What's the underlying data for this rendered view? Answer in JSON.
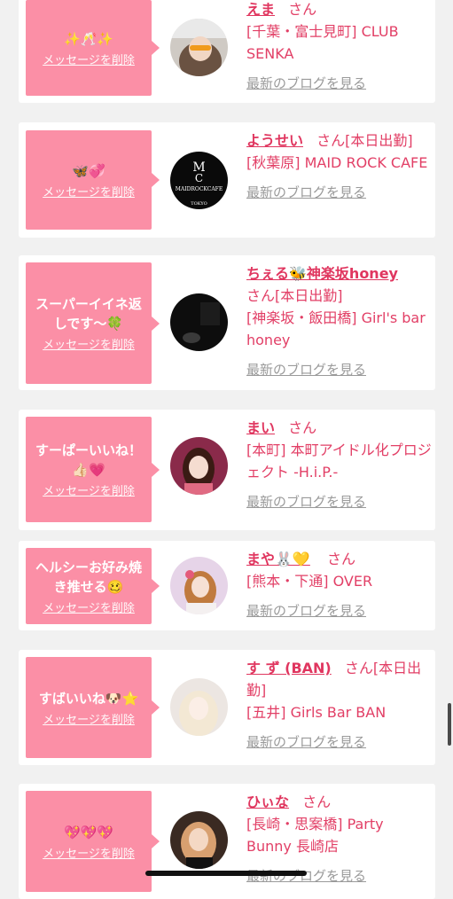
{
  "delete_label": "メッセージを削除",
  "blog_label": "最新のブログを見る",
  "san": "さん",
  "colors": {
    "bubble": "#fb8fa6",
    "accent": "#e0365f",
    "muted": "#9a9a9a"
  },
  "entries": [
    {
      "message": "✨🥂✨",
      "name": "えま",
      "status": "",
      "shop": "[千葉・富士見町] CLUB SENKA",
      "avatar": "avatar-photo"
    },
    {
      "message": "🦋💞",
      "name": "ようせい",
      "status": "[本日出勤]",
      "shop": "[秋葉原] MAID ROCK CAFE",
      "avatar": "maidrock-logo"
    },
    {
      "message": "スーパーイイネ返しです〜🍀",
      "name": "ちぇる🐝神楽坂honey",
      "status": "[本日出勤]",
      "shop": "[神楽坂・飯田橋] Girl's bar honey",
      "avatar": "avatar-photo"
    },
    {
      "message": "すーぱーいいね！👍🏻💗",
      "name": "まい",
      "status": "",
      "shop": "[本町] 本町アイドル化プロジェクト -H.i.P.-",
      "avatar": "avatar-photo"
    },
    {
      "message": "ヘルシーお好み焼き推せる🥴",
      "name": "まや🐰💛",
      "status": "",
      "shop": "[熊本・下通] OVER",
      "avatar": "avatar-photo"
    },
    {
      "message": "すばいいね🐶⭐",
      "name": "す ず (BAN)",
      "status": "[本日出勤]",
      "shop": "[五井] Girls Bar BAN",
      "avatar": "avatar-photo"
    },
    {
      "message": "💖💖💖",
      "name": "ひぃな",
      "status": "",
      "shop": "[長崎・思案橋] Party Bunny 長崎店",
      "avatar": "avatar-photo"
    }
  ],
  "maidrock": {
    "line1": "MAIDROCKCAFE",
    "line2": "TOKYO"
  }
}
